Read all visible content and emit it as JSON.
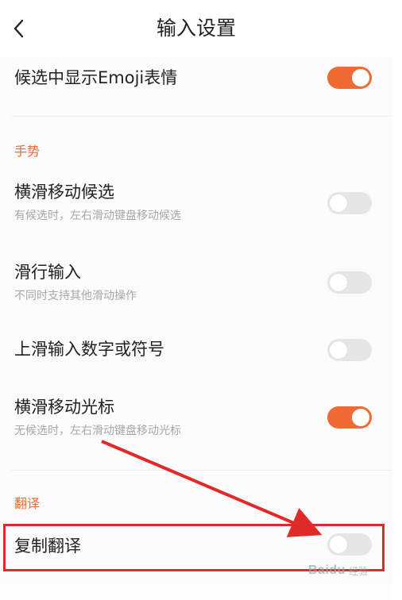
{
  "header": {
    "title": "输入设置",
    "back_icon": "chevron-left-icon"
  },
  "top_row": {
    "title": "候选中显示Emoji表情",
    "toggle_on": true
  },
  "sections": [
    {
      "label": "手势",
      "rows": [
        {
          "title": "横滑移动候选",
          "subtitle": "有候选时，左右滑动键盘移动候选",
          "toggle_on": false
        },
        {
          "title": "滑行输入",
          "subtitle": "不同时支持其他滑动操作",
          "toggle_on": false
        },
        {
          "title": "上滑输入数字或符号",
          "subtitle": "",
          "toggle_on": false
        },
        {
          "title": "横滑移动光标",
          "subtitle": "无候选时，左右滑动键盘移动光标",
          "toggle_on": true
        }
      ]
    },
    {
      "label": "翻译",
      "rows": [
        {
          "title": "复制翻译",
          "subtitle": "",
          "toggle_on": false
        }
      ]
    }
  ],
  "colors": {
    "accent": "#f06b34",
    "section_label": "#ee6a35",
    "annotation": "#e02a2a"
  },
  "watermark": {
    "text": "Baidu",
    "sub": "经验"
  }
}
